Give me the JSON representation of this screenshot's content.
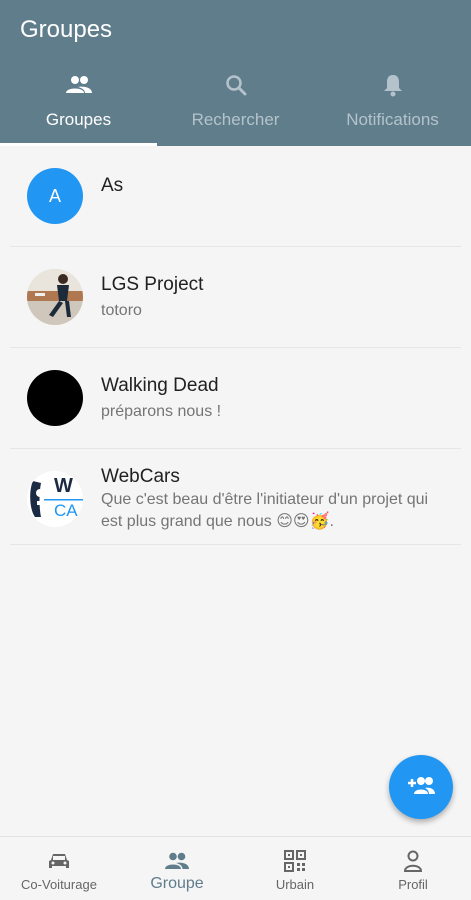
{
  "app": {
    "title": "Groupes"
  },
  "tabs": [
    {
      "label": "Groupes",
      "icon": "people-icon",
      "active": true
    },
    {
      "label": "Rechercher",
      "icon": "search-icon",
      "active": false
    },
    {
      "label": "Notifications",
      "icon": "bell-icon",
      "active": false
    }
  ],
  "groups": [
    {
      "name": "As",
      "subtitle": "",
      "avatar_letter": "A",
      "avatar_color": "#2196f3"
    },
    {
      "name": "LGS Project",
      "subtitle": "totoro",
      "avatar": "photo-avatar"
    },
    {
      "name": "Walking Dead",
      "subtitle": "préparons nous !",
      "avatar_color": "#000000"
    },
    {
      "name": "WebCars",
      "subtitle": "Que c'est beau d'être l'initiateur d'un projet qui est plus grand que nous 😊😍🥳.",
      "avatar": "logo-avatar",
      "logo_text_1": "W",
      "logo_text_2": "CA"
    }
  ],
  "fab": {
    "icon": "group-add-icon"
  },
  "bottom_nav": [
    {
      "label": "Co-Voiturage",
      "icon": "car-icon",
      "active": false
    },
    {
      "label": "Groupe",
      "icon": "people-icon",
      "active": true
    },
    {
      "label": "Urbain",
      "icon": "qr-code-icon",
      "active": false
    },
    {
      "label": "Profil",
      "icon": "person-icon",
      "active": false
    }
  ],
  "colors": {
    "app_bar": "#607d8b",
    "accent": "#2196f3",
    "tab_indicator": "#ffffff"
  }
}
